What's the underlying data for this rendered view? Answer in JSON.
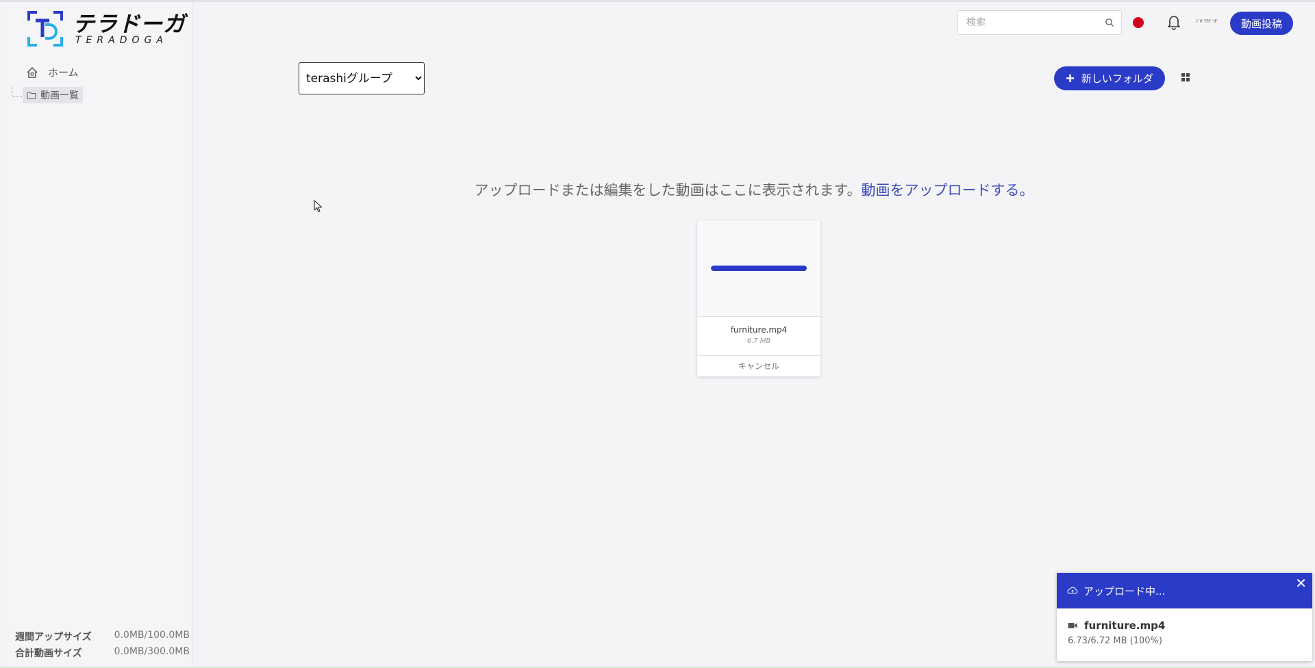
{
  "brand": {
    "name_jp": "テラドーガ",
    "name_en": "TERADOGA"
  },
  "sidebar": {
    "items": [
      {
        "label": "ホーム",
        "icon": "home-icon"
      },
      {
        "label": "動画一覧",
        "icon": "folder-icon"
      }
    ],
    "quota": [
      {
        "label": "週間アップサイズ",
        "value": "0.0MB/100.0MB"
      },
      {
        "label": "合計動画サイズ",
        "value": "0.0MB/300.0MB"
      }
    ]
  },
  "header": {
    "search_placeholder": "検索",
    "account_logo_text": "ｼﾞﾎﾞﾃﾗﾄﾞｰｶﾞ",
    "post_button": "動画投稿"
  },
  "toolbar": {
    "group_options": [
      "terashiグループ"
    ],
    "group_selected": "terashiグループ",
    "new_folder": "新しいフォルダ"
  },
  "empty_state": {
    "text": "アップロードまたは編集をした動画はここに表示されます。",
    "link": "動画をアップロードする。"
  },
  "upload_card": {
    "filename": "furniture.mp4",
    "size": "6.7 MB",
    "progress": 1.0,
    "cancel": "キャンセル"
  },
  "upload_toast": {
    "title": "アップロード中...",
    "filename": "furniture.mp4",
    "progress_text": "6.73/6.72 MB (100%)"
  },
  "colors": {
    "accent": "#2a3bc7",
    "record": "#d0021b",
    "background": "#f4f3f6"
  }
}
